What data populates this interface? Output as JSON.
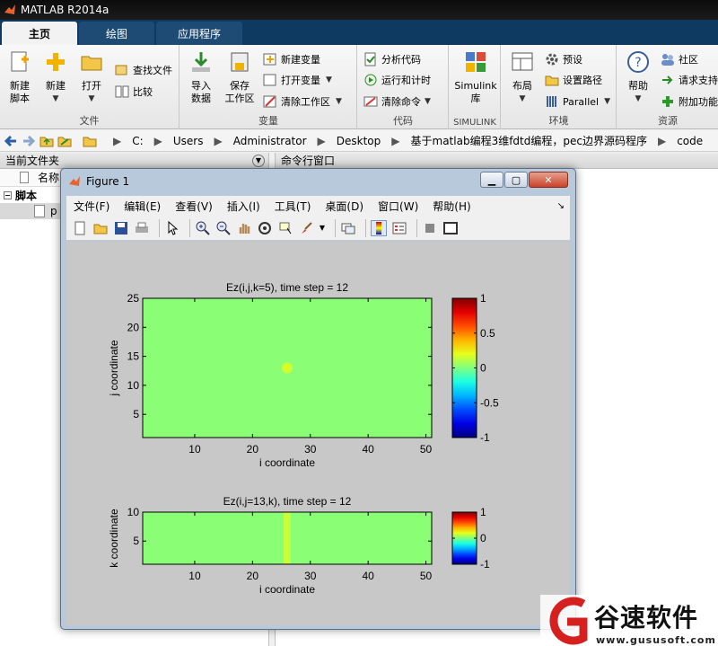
{
  "app": {
    "title": "MATLAB R2014a"
  },
  "tabs": [
    {
      "label": "主页",
      "active": true
    },
    {
      "label": "绘图",
      "active": false
    },
    {
      "label": "应用程序",
      "active": false
    }
  ],
  "ribbon": {
    "file": {
      "caption": "文件",
      "new_script": "新建\n脚本",
      "new": "新建",
      "open": "打开",
      "find_files": "查找文件",
      "compare": "比较"
    },
    "variable": {
      "caption": "变量",
      "import": "导入\n数据",
      "save_ws": "保存\n工作区",
      "new_var": "新建变量",
      "open_var": "打开变量",
      "clear_ws": "清除工作区"
    },
    "code": {
      "caption": "代码",
      "analyze": "分析代码",
      "run_time": "运行和计时",
      "clear_cmd": "清除命令"
    },
    "simulink": {
      "caption": "SIMULINK",
      "lib": "Simulink\n库"
    },
    "env": {
      "caption": "环境",
      "layout": "布局",
      "prefs": "预设",
      "set_path": "设置路径",
      "parallel": "Parallel"
    },
    "resources": {
      "caption": "资源",
      "help": "帮助",
      "community": "社区",
      "request": "请求支持",
      "addons": "附加功能"
    }
  },
  "address": {
    "crumbs": [
      "C:",
      "Users",
      "Administrator",
      "Desktop",
      "基于matlab编程3维fdtd编程，pec边界源码程序",
      "code"
    ]
  },
  "left_pane": {
    "title": "当前文件夹",
    "col_name": "名称",
    "group": "脚本",
    "file_partial": "p"
  },
  "cmd_pane": {
    "title": "命令行窗口"
  },
  "figure": {
    "title": "Figure 1",
    "menus": [
      "文件(F)",
      "编辑(E)",
      "查看(V)",
      "插入(I)",
      "工具(T)",
      "桌面(D)",
      "窗口(W)",
      "帮助(H)"
    ],
    "toolbar_icons": [
      "new-figure-icon",
      "open-icon",
      "save-icon",
      "print-icon",
      "pointer-icon",
      "zoom-in-icon",
      "zoom-out-icon",
      "pan-icon",
      "rotate-icon",
      "data-cursor-icon",
      "brush-icon",
      "link-icon",
      "colorbar-icon",
      "legend-icon",
      "hide-tools-icon",
      "dock-icon"
    ]
  },
  "chart_data": [
    {
      "type": "heatmap",
      "title": "Ez(i,j,k=5), time step = 12",
      "xlabel": "i coordinate",
      "ylabel": "j coordinate",
      "xlim": [
        1,
        51
      ],
      "ylim": [
        1,
        25
      ],
      "xticks": [
        10,
        20,
        30,
        40,
        50
      ],
      "yticks": [
        5,
        10,
        15,
        20,
        25
      ],
      "background_value": 0.02,
      "peak": {
        "x": 26,
        "y": 13,
        "value": 0.2
      },
      "colorbar": {
        "ticks": [
          1,
          0.5,
          0,
          -0.5,
          -1
        ],
        "range": [
          -1,
          1
        ],
        "colormap": "jet"
      }
    },
    {
      "type": "heatmap",
      "title": "Ez(i,j=13,k), time step = 12",
      "xlabel": "i coordinate",
      "ylabel": "k coordinate",
      "xlim": [
        1,
        51
      ],
      "ylim": [
        1,
        10
      ],
      "xticks": [
        10,
        20,
        30,
        40,
        50
      ],
      "yticks": [
        5,
        10
      ],
      "background_value": 0.02,
      "peak": {
        "x": 26,
        "value": 0.15
      },
      "colorbar": {
        "ticks": [
          1,
          0,
          -1
        ],
        "range": [
          -1,
          1
        ],
        "colormap": "jet"
      }
    }
  ],
  "watermark": {
    "brand": "谷速软件",
    "url": "www.gususoft.com"
  }
}
